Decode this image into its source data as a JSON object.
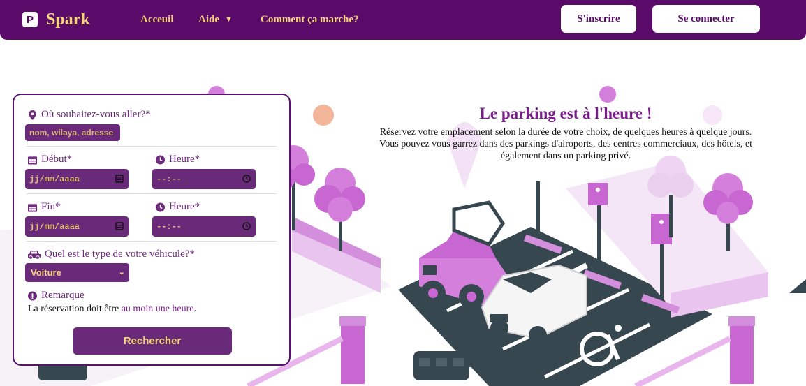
{
  "brand": {
    "logo_letter": "P",
    "name": "Spark"
  },
  "nav": {
    "links": [
      {
        "label": "Acceuil"
      },
      {
        "label": "Aide"
      },
      {
        "label": "Comment ça marche?"
      }
    ],
    "signup_label": "S'inscrire",
    "login_label": "Se connecter"
  },
  "hero": {
    "title": "Le parking est à l'heure !",
    "text": "Réservez votre emplacement selon la durée de votre choix, de quelques heures à quelque jours. Vous pouvez vous garrez dans des parkings d'airoports, des centres commerciaux, des hôtels, et également dans un parking privé."
  },
  "form": {
    "destination_label": "Où souhaitez-vous aller?*",
    "destination_placeholder": "nom, wilaya, adresse",
    "start_date_label": "Début*",
    "start_time_label": "Heure*",
    "end_date_label": "Fin*",
    "end_time_label": "Heure*",
    "date_placeholder": "jj/mm/aaaa",
    "time_placeholder": "--:--",
    "vehicle_label": "Quel est le type de votre véhicule?*",
    "vehicle_value": "Voiture",
    "remark_title": "Remarque",
    "remark_prefix": "La réservation doit être ",
    "remark_highlight": "au moin une heure",
    "remark_suffix": ".",
    "search_label": "Rechercher"
  },
  "colors": {
    "primary": "#5a0b6a",
    "field": "#6a2a7a",
    "accent_text": "#f5d57a",
    "illustration_pink": "#c86ad0",
    "illustration_dark": "#37474f"
  }
}
